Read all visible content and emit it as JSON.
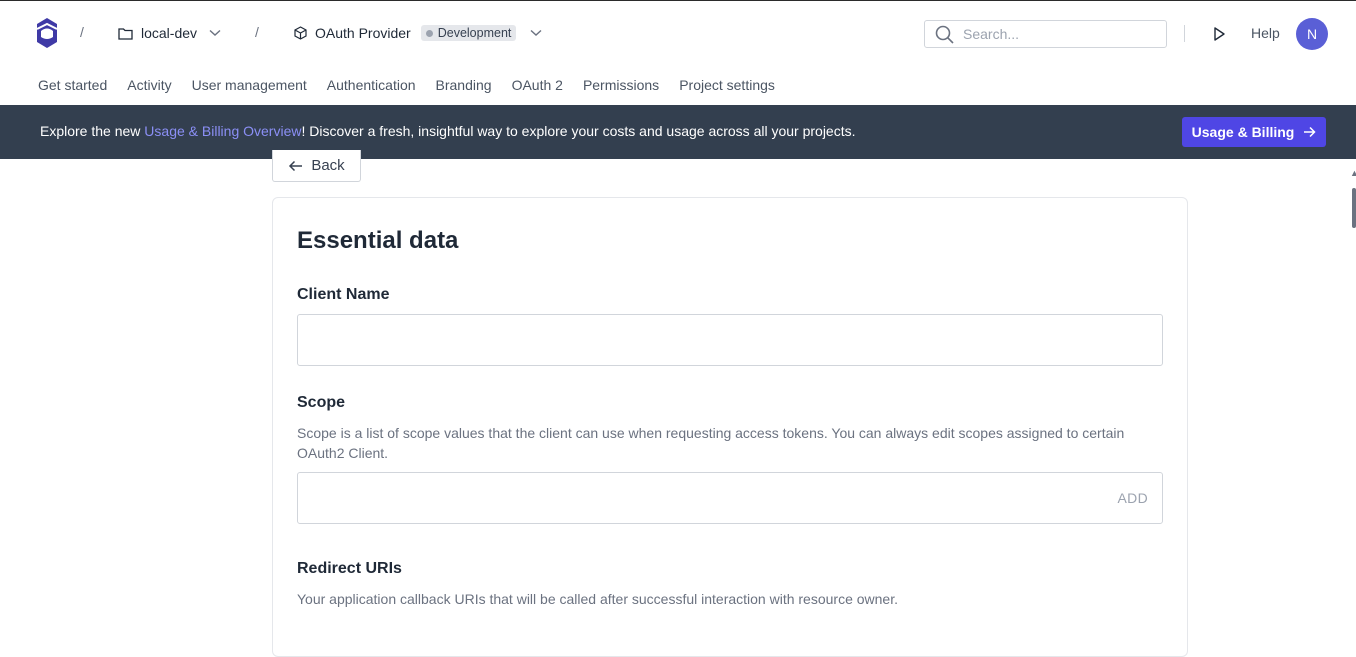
{
  "header": {
    "breadcrumb_sep": "/",
    "workspace": "local-dev",
    "project": "OAuth Provider",
    "environment": "Development",
    "search_placeholder": "Search...",
    "help_label": "Help",
    "avatar_initial": "N"
  },
  "nav": {
    "items": [
      "Get started",
      "Activity",
      "User management",
      "Authentication",
      "Branding",
      "OAuth 2",
      "Permissions",
      "Project settings"
    ]
  },
  "banner": {
    "prefix": "Explore the new ",
    "link": "Usage & Billing Overview",
    "suffix": "! Discover a fresh, insightful way to explore your costs and usage across all your projects.",
    "button": "Usage & Billing"
  },
  "back_label": "Back",
  "form": {
    "title": "Essential data",
    "client_name_label": "Client Name",
    "client_name_value": "",
    "scope_label": "Scope",
    "scope_desc": "Scope is a list of scope values that the client can use when requesting access tokens. You can always edit scopes assigned to certain OAuth2 Client.",
    "scope_add": "ADD",
    "redirect_label": "Redirect URIs",
    "redirect_desc": "Your application callback URIs that will be called after successful interaction with resource owner."
  },
  "colors": {
    "accent": "#4f46e5",
    "banner_bg": "#333f4f",
    "avatar": "#5a5fd6"
  }
}
